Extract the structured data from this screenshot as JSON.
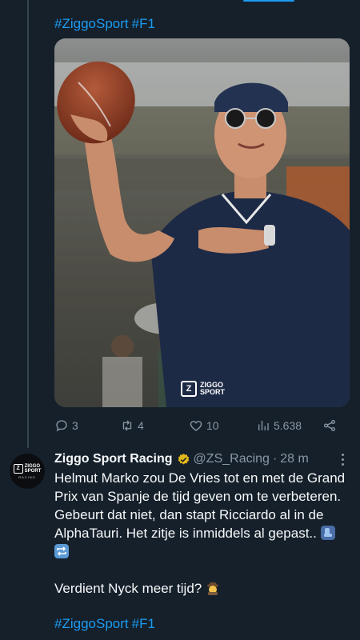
{
  "tweet1": {
    "hashtags": [
      "#ZiggoSport",
      "#F1"
    ],
    "media_watermark": {
      "line1": "ZIGGO",
      "line2": "SPORT"
    },
    "stats": {
      "replies": "3",
      "retweets": "4",
      "likes": "10",
      "views": "5.638"
    }
  },
  "tweet2": {
    "display_name": "Ziggo Sport Racing",
    "handle": "@ZS_Racing",
    "separator": "·",
    "time": "28 m",
    "avatar_text": {
      "line1": "ZIGGO",
      "line2": "SPORT",
      "line3": "RACING"
    },
    "text_paragraph_1": "Helmut Marko zou De Vries tot en met de Grand Prix van Spanje de tijd geven om te verbeteren. Gebeurt dat niet, dan stapt Ricciardo al in de AlphaTauri. Het zitje is inmiddels al gepast..",
    "text_paragraph_2": "Verdient Nyck meer tijd?",
    "hashtags": [
      "#ZiggoSport",
      "#F1"
    ]
  },
  "colors": {
    "background": "#15202b",
    "accent": "#1d9bf0",
    "secondary_text": "#8b98a5",
    "verified_badge": "#e2b719"
  },
  "icons": [
    "reply-icon",
    "retweet-icon",
    "like-icon",
    "views-icon",
    "share-icon",
    "verified-badge-icon",
    "more-options-icon",
    "seat-emoji-icon",
    "repeat-emoji-icon",
    "detective-emoji-icon"
  ]
}
